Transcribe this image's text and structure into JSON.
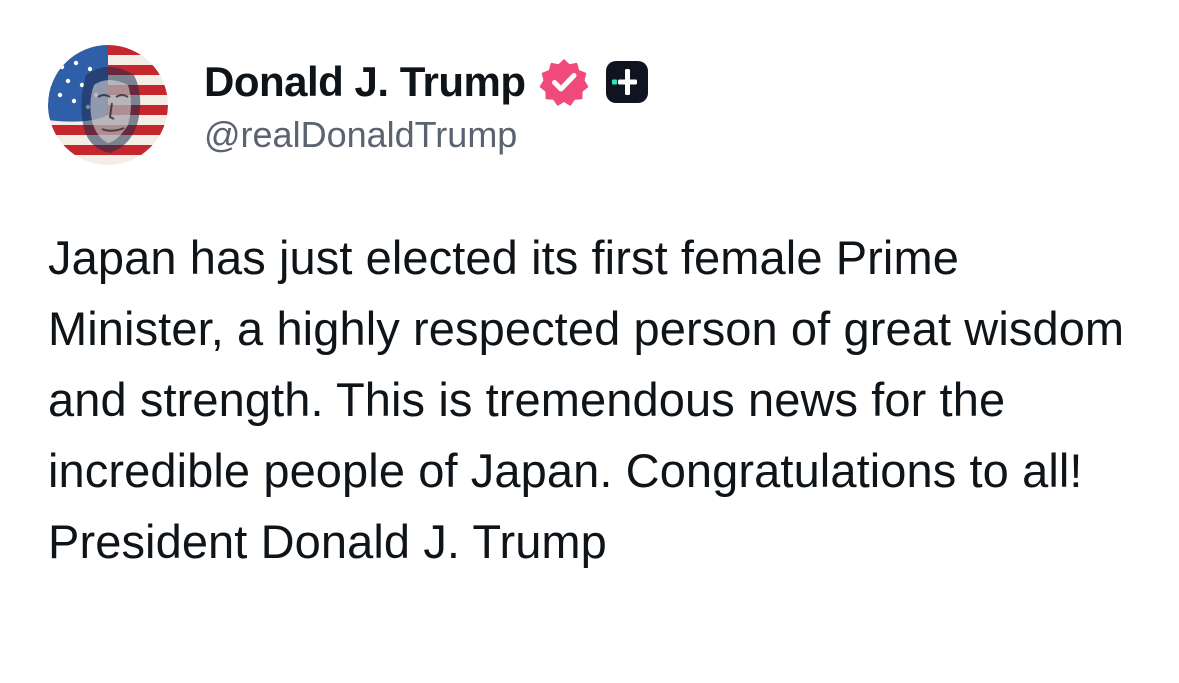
{
  "post": {
    "author": {
      "display_name": "Donald J. Trump",
      "handle": "@realDonaldTrump",
      "verified_icon": "verified-badge-icon",
      "extra_icon": "plus-badge-icon",
      "verified_color": "#ef4a7a",
      "extra_badge_color": "#0f1420",
      "extra_badge_accent": "#2ee6b8"
    },
    "body": "Japan has just elected its first female Prime Minister, a highly respected person of great wisdom and strength. This is tremendous news for the incredible people of Japan. Congratulations to all! President Donald J. Trump"
  }
}
